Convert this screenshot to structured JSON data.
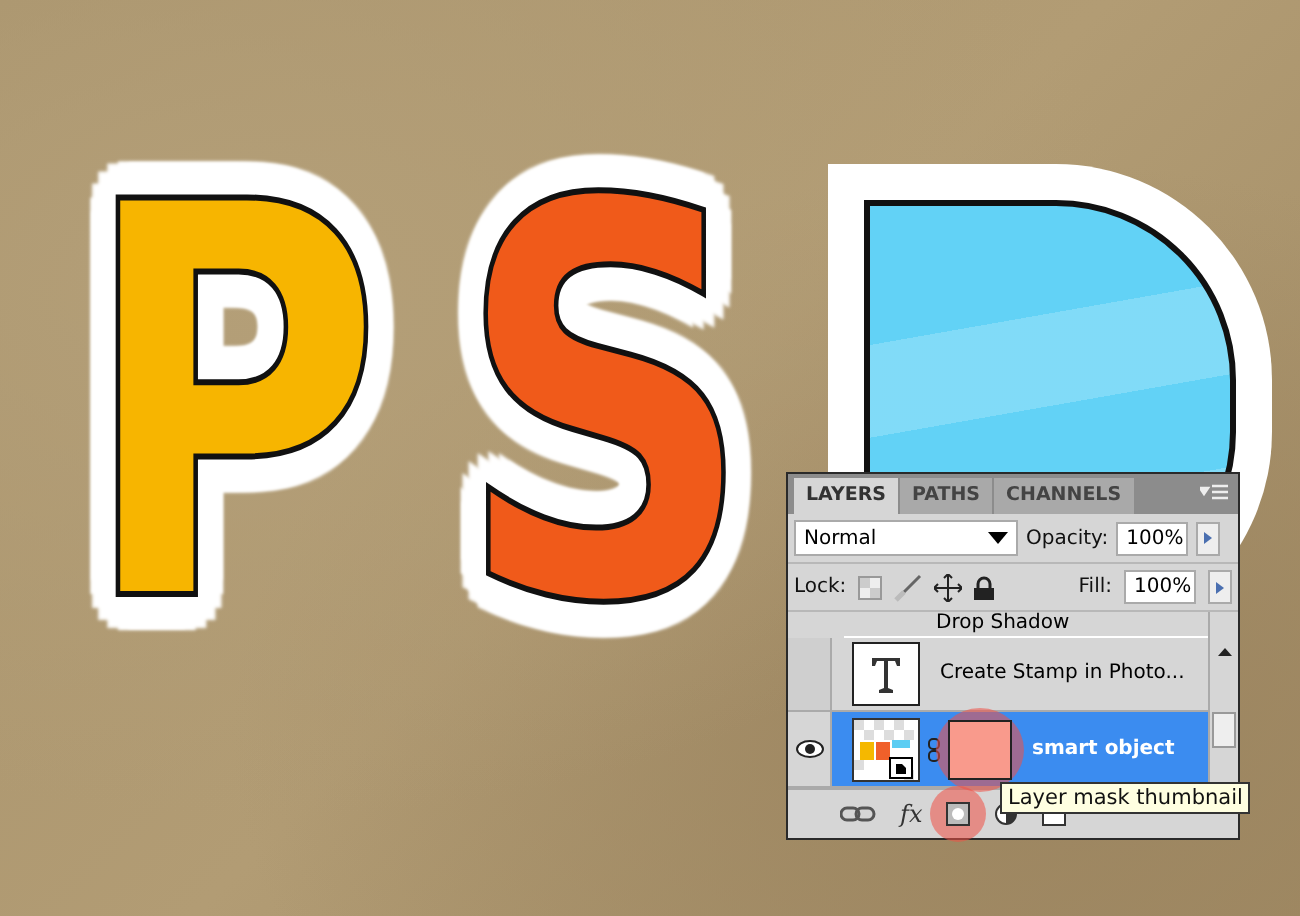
{
  "artwork": {
    "letters": [
      {
        "char": "P",
        "color": "#f7b500"
      },
      {
        "char": "S",
        "color": "#f05a1a"
      }
    ]
  },
  "panel": {
    "tabs": [
      {
        "label": "LAYERS",
        "selected": true
      },
      {
        "label": "PATHS",
        "selected": false
      },
      {
        "label": "CHANNELS",
        "selected": false
      }
    ],
    "blend_mode": "Normal",
    "opacity_label": "Opacity:",
    "opacity": "100%",
    "lock_label": "Lock:",
    "fill_label": "Fill:",
    "fill": "100%",
    "layers": [
      {
        "kind": "effect",
        "name": "Drop Shadow"
      },
      {
        "kind": "text",
        "name": "Create Stamp in Photo...",
        "visible": false,
        "selected": false
      },
      {
        "kind": "smart",
        "name": "smart object",
        "visible": true,
        "selected": true,
        "highlighted": true
      }
    ],
    "fx_label": "fx",
    "mask_button_highlighted": true
  },
  "tooltip": "Layer mask thumbnail"
}
